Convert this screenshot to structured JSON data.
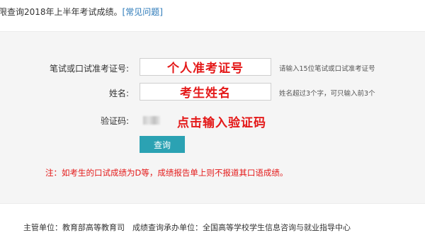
{
  "notice": {
    "text": "限查询2018年上半年考试成绩。",
    "link": "[常见问题]"
  },
  "form": {
    "ticket": {
      "label": "笔试或口试准考证号:",
      "overlay": "个人准考证号",
      "hint": "请输入15位笔试或口试准考证号"
    },
    "name": {
      "label": "姓名:",
      "overlay": "考生姓名",
      "hint": "姓名超过3个字，可只输入前3个"
    },
    "captcha": {
      "label": "验证码:",
      "overlay": "点击输入验证码"
    },
    "submit_label": "查询",
    "note": "注：如考生的口试成绩为D等，成绩报告单上则不报道其口语成绩。"
  },
  "footer": {
    "text": "主管单位：教育部高等教育司　成绩查询承办单位：全国高等学校学生信息咨询与就业指导中心"
  }
}
